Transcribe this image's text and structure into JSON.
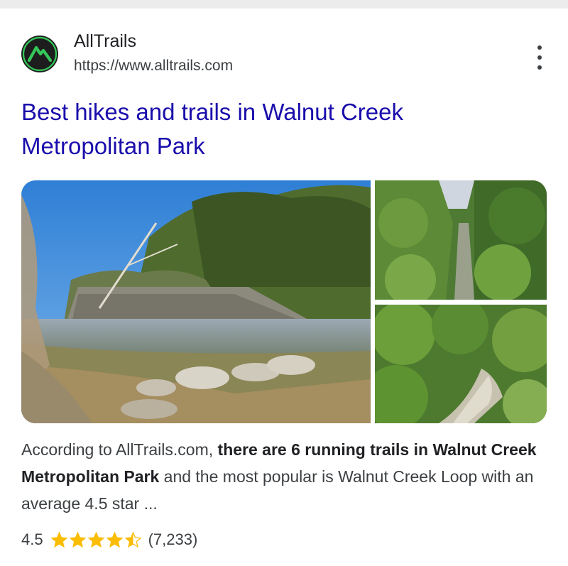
{
  "result": {
    "site_name": "AllTrails",
    "url": "https://www.alltrails.com",
    "title_line1": "Best hikes and trails in Walnut Creek",
    "title_line2": "Metropolitan Park",
    "snippet": {
      "part1": "According to AllTrails.com, ",
      "bold1": "there are 6 running trails in Walnut Creek Metropolitan Park",
      "part2": " and the most popular is Walnut Creek Loop with an average 4.5 star ..."
    },
    "rating": {
      "value": "4.5",
      "stars": 4.5,
      "max_stars": 5,
      "count": "(7,233)"
    }
  },
  "images": [
    "creek-bank-photo",
    "trail-aerial-photo-1",
    "trail-aerial-photo-2"
  ],
  "colors": {
    "title_link": "#1a0dab",
    "body_text": "#3c4043",
    "star": "#fbbc04",
    "icon_green": "#34c759"
  },
  "icons": {
    "site": "alltrails-mountain-icon",
    "menu": "more-vert-icon",
    "star": "star-icon"
  }
}
